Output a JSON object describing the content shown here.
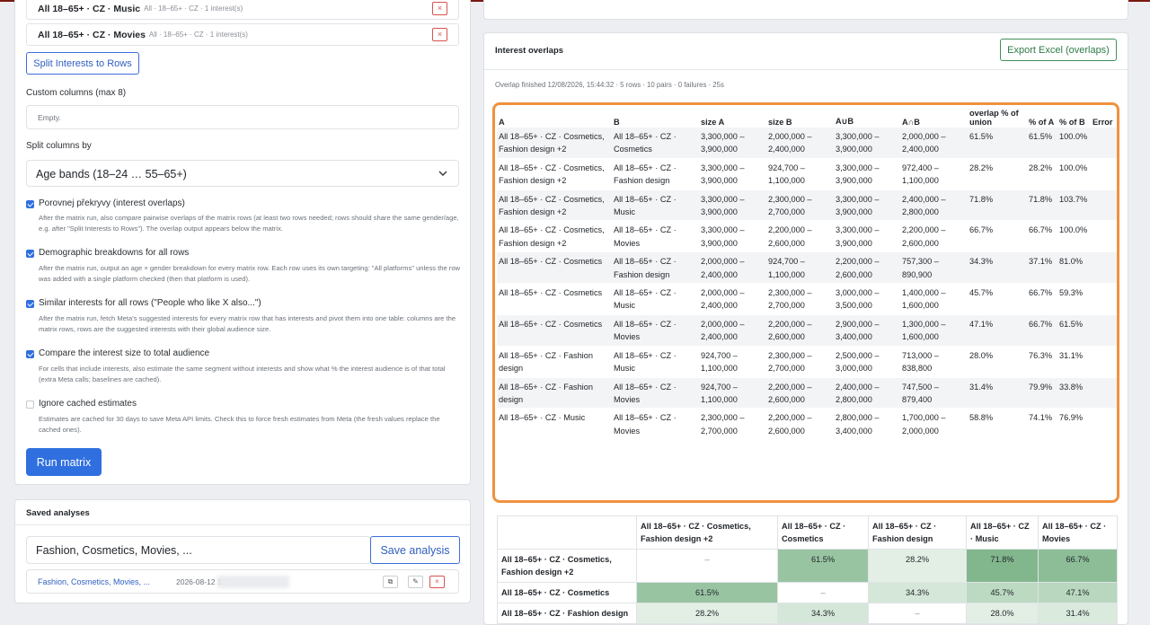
{
  "left": {
    "interest_rows": [
      {
        "title": "All 18–65+ · CZ · Music",
        "meta": "All · 18–65+ · CZ · 1 interest(s)",
        "remove": "×"
      },
      {
        "title": "All 18–65+ · CZ · Movies",
        "meta": "All · 18–65+ · CZ · 1 interest(s)",
        "remove": "×"
      }
    ],
    "split_interests_label": "Split Interests to Rows",
    "custom_columns_label": "Custom columns (max 8)",
    "custom_columns_value": "Empty.",
    "split_columns_label": "Split columns by",
    "split_columns_value": "Age bands (18–24 … 55–65+)",
    "options": [
      {
        "checked": true,
        "label": "Porovnej překryvy (interest overlaps)",
        "desc": "After the matrix run, also compare pairwise overlaps of the matrix rows (at least two rows needed; rows should share the same gender/age, e.g. after \"Split Interests to Rows\"). The overlap output appears below the matrix."
      },
      {
        "checked": true,
        "label": "Demographic breakdowns for all rows",
        "desc": "After the matrix run, output an age × gender breakdown for every matrix row. Each row uses its own targeting: \"All platforms\" unless the row was added with a single platform checked (then that platform is used)."
      },
      {
        "checked": true,
        "label": "Similar interests for all rows (\"People who like X also...\")",
        "desc": "After the matrix run, fetch Meta's suggested interests for every matrix row that has interests and pivot them into one table: columns are the matrix rows, rows are the suggested interests with their global audience size."
      },
      {
        "checked": true,
        "label": "Compare the interest size to total audience",
        "desc": "For cells that include interests, also estimate the same segment without interests and show what % the interest audience is of that total (extra Meta calls; baselines are cached)."
      },
      {
        "checked": false,
        "label": "Ignore cached estimates",
        "desc": "Estimates are cached for 30 days to save Meta API limits. Check this to force fresh estimates from Meta (the fresh values replace the cached ones)."
      }
    ],
    "run_label": "Run matrix"
  },
  "saved": {
    "title": "Saved analyses",
    "name_value": "Fashion, Cosmetics, Movies, ...",
    "save_label": "Save analysis",
    "items": [
      {
        "name": "Fashion, Cosmetics, Movies, ...",
        "date": "2026-08-12 13:"
      }
    ]
  },
  "overlaps": {
    "title": "Interest overlaps",
    "export_label": "Export Excel (overlaps)",
    "status": "Overlap finished 12/08/2026, 15:44:32 · 5 rows · 10 pairs · 0 failures · 25s",
    "columns": [
      "A",
      "B",
      "size A",
      "size B",
      "A∪B",
      "A∩B",
      "overlap % of union",
      "% of A",
      "% of B",
      "Error"
    ],
    "rows": [
      [
        "All 18–65+ · CZ · Cosmetics, Fashion design +2",
        "All 18–65+ · CZ · Cosmetics",
        "3,300,000 – 3,900,000",
        "2,000,000 – 2,400,000",
        "3,300,000 – 3,900,000",
        "2,000,000 – 2,400,000",
        "61.5%",
        "61.5%",
        "100.0%",
        ""
      ],
      [
        "All 18–65+ · CZ · Cosmetics, Fashion design +2",
        "All 18–65+ · CZ · Fashion design",
        "3,300,000 – 3,900,000",
        "924,700 – 1,100,000",
        "3,300,000 – 3,900,000",
        "972,400 – 1,100,000",
        "28.2%",
        "28.2%",
        "100.0%",
        ""
      ],
      [
        "All 18–65+ · CZ · Cosmetics, Fashion design +2",
        "All 18–65+ · CZ · Music",
        "3,300,000 – 3,900,000",
        "2,300,000 – 2,700,000",
        "3,300,000 – 3,900,000",
        "2,400,000 – 2,800,000",
        "71.8%",
        "71.8%",
        "103.7%",
        ""
      ],
      [
        "All 18–65+ · CZ · Cosmetics, Fashion design +2",
        "All 18–65+ · CZ · Movies",
        "3,300,000 – 3,900,000",
        "2,200,000 – 2,600,000",
        "3,300,000 – 3,900,000",
        "2,200,000 – 2,600,000",
        "66.7%",
        "66.7%",
        "100.0%",
        ""
      ],
      [
        "All 18–65+ · CZ · Cosmetics",
        "All 18–65+ · CZ · Fashion design",
        "2,000,000 – 2,400,000",
        "924,700 – 1,100,000",
        "2,200,000 – 2,600,000",
        "757,300 – 890,900",
        "34.3%",
        "37.1%",
        "81.0%",
        ""
      ],
      [
        "All 18–65+ · CZ · Cosmetics",
        "All 18–65+ · CZ · Music",
        "2,000,000 – 2,400,000",
        "2,300,000 – 2,700,000",
        "3,000,000 – 3,500,000",
        "1,400,000 – 1,600,000",
        "45.7%",
        "66.7%",
        "59.3%",
        ""
      ],
      [
        "All 18–65+ · CZ · Cosmetics",
        "All 18–65+ · CZ · Movies",
        "2,000,000 – 2,400,000",
        "2,200,000 – 2,600,000",
        "2,900,000 – 3,400,000",
        "1,300,000 – 1,600,000",
        "47.1%",
        "66.7%",
        "61.5%",
        ""
      ],
      [
        "All 18–65+ · CZ · Fashion design",
        "All 18–65+ · CZ · Music",
        "924,700 – 1,100,000",
        "2,300,000 – 2,700,000",
        "2,500,000 – 3,000,000",
        "713,000 – 838,800",
        "28.0%",
        "76.3%",
        "31.1%",
        ""
      ],
      [
        "All 18–65+ · CZ · Fashion design",
        "All 18–65+ · CZ · Movies",
        "924,700 – 1,100,000",
        "2,200,000 – 2,600,000",
        "2,400,000 – 2,800,000",
        "747,500 – 879,400",
        "31.4%",
        "79.9%",
        "33.8%",
        ""
      ],
      [
        "All 18–65+ · CZ · Music",
        "All 18–65+ · CZ · Movies",
        "2,300,000 – 2,700,000",
        "2,200,000 – 2,600,000",
        "2,800,000 – 3,400,000",
        "1,700,000 – 2,000,000",
        "58.8%",
        "74.1%",
        "76.9%",
        ""
      ]
    ]
  },
  "matrix": {
    "columns": [
      "All 18–65+ · CZ · Cosmetics, Fashion design +2",
      "All 18–65+ · CZ · Cosmetics",
      "All 18–65+ · CZ · Fashion design",
      "All 18–65+ · CZ · Music",
      "All 18–65+ · CZ · Movies"
    ],
    "rows": [
      {
        "label": "All 18–65+ · CZ · Cosmetics, Fashion design +2",
        "cells": [
          "–",
          "61.5%",
          "28.2%",
          "71.8%",
          "66.7%"
        ],
        "shade": [
          null,
          0.615,
          0.282,
          0.718,
          0.667
        ]
      },
      {
        "label": "All 18–65+ · CZ · Cosmetics",
        "cells": [
          "61.5%",
          "–",
          "34.3%",
          "45.7%",
          "47.1%"
        ],
        "shade": [
          0.615,
          null,
          0.343,
          0.457,
          0.471
        ]
      },
      {
        "label": "All 18–65+ · CZ · Fashion design",
        "cells": [
          "28.2%",
          "34.3%",
          "–",
          "28.0%",
          "31.4%"
        ],
        "shade": [
          0.282,
          0.343,
          null,
          0.28,
          0.314
        ]
      }
    ],
    "heat_color": "#4f9a5f"
  }
}
